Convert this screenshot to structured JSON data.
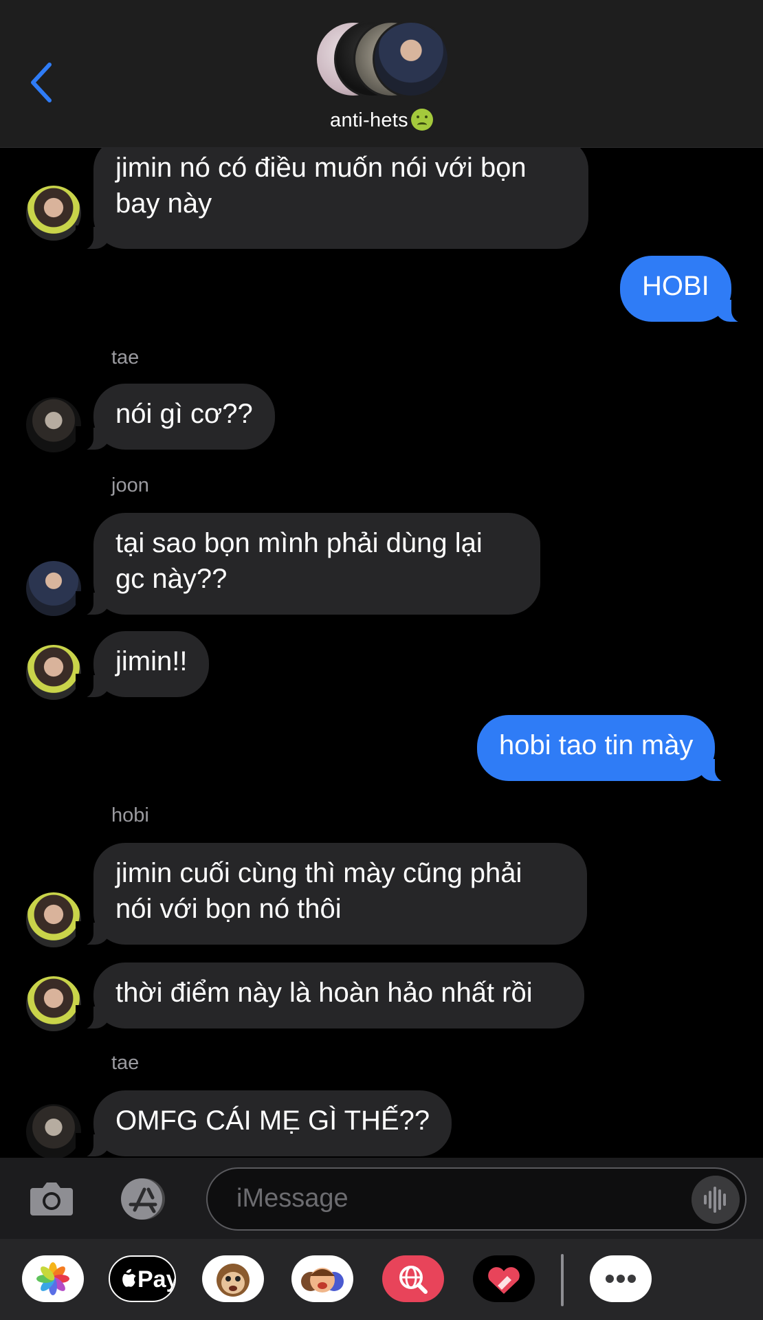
{
  "header": {
    "back_icon": "chevron-left-icon",
    "group_name": "anti-hets",
    "group_emoji": "nauseated-face-emoji",
    "accent_color": "#2f7cf6"
  },
  "messages": [
    {
      "sender": "",
      "direction": "in",
      "text": "jimin nó có điều muốn nói với bọn\nbay này",
      "avatar": "hobi"
    },
    {
      "sender": "",
      "direction": "out",
      "text": "HOBI"
    },
    {
      "sender": "tae",
      "direction": "in",
      "text": "nói gì cơ??",
      "avatar": "tae"
    },
    {
      "sender": "joon",
      "direction": "in",
      "text": "tại sao bọn mình phải dùng lại\ngc này??",
      "avatar": "joon"
    },
    {
      "sender": "",
      "direction": "in",
      "text": "jimin!!",
      "avatar": "hobi"
    },
    {
      "sender": "",
      "direction": "out",
      "text": "hobi tao tin mày"
    },
    {
      "sender": "hobi",
      "direction": "in",
      "text": "jimin cuối cùng thì mày cũng phải\nnói với bọn nó thôi",
      "avatar": "hobi"
    },
    {
      "sender": "",
      "direction": "in",
      "text": "thời điểm này là hoàn hảo nhất rồi",
      "avatar": "hobi"
    },
    {
      "sender": "tae",
      "direction": "in",
      "text": "OMFG CÁI MẸ GÌ THẾ??",
      "avatar": "tae"
    }
  ],
  "input": {
    "placeholder": "iMessage",
    "camera_icon": "camera-icon",
    "apps_icon": "app-store-icon",
    "audio_icon": "audio-waveform-icon"
  },
  "drawer": {
    "apps": [
      "photos-icon",
      "apple-pay-icon",
      "animoji-icon",
      "memoji-icon",
      "web-search-icon",
      "digital-touch-icon",
      "more-icon"
    ],
    "apple_pay_label": "Pay"
  }
}
